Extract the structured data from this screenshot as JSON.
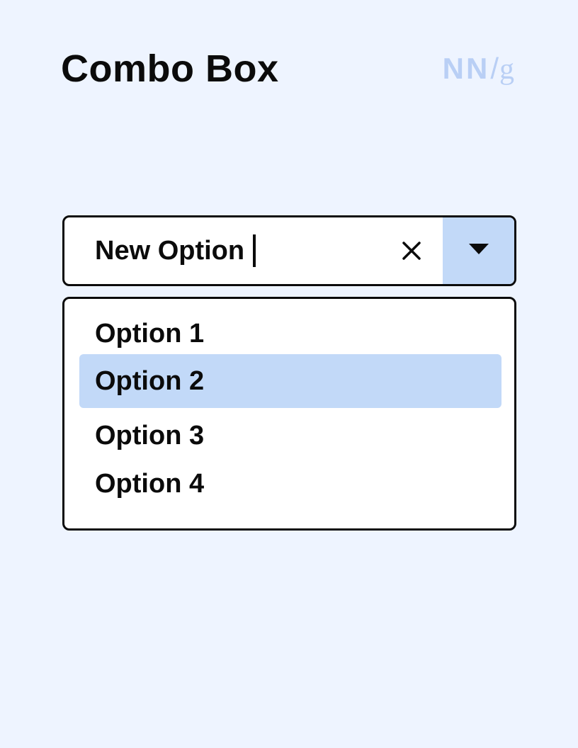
{
  "header": {
    "title": "Combo Box",
    "logo": {
      "nn": "NN",
      "slash": "/",
      "g": "g"
    }
  },
  "combo": {
    "value": "New Option",
    "clear_icon": "close-icon",
    "toggle_icon": "triangle-down-icon",
    "accent_color": "#c2d9f8"
  },
  "listbox": {
    "options": [
      {
        "label": "Option 1",
        "selected": false
      },
      {
        "label": "Option 2",
        "selected": true
      },
      {
        "label": "Option 3",
        "selected": false
      },
      {
        "label": "Option 4",
        "selected": false
      }
    ]
  },
  "colors": {
    "background": "#eef4ff",
    "highlight": "#c2d9f8",
    "logo": "#b9cff5",
    "text": "#0b0b0b"
  }
}
